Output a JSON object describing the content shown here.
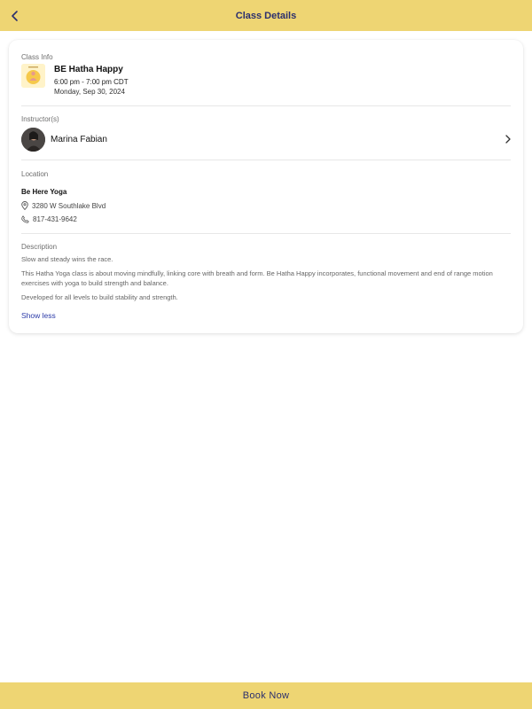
{
  "header": {
    "title": "Class Details"
  },
  "class_info": {
    "label": "Class Info",
    "title": "BE Hatha Happy",
    "time": "6:00 pm - 7:00 pm CDT",
    "date": "Monday, Sep 30, 2024"
  },
  "instructors": {
    "label": "Instructor(s)",
    "name": "Marina Fabian"
  },
  "location": {
    "label": "Location",
    "name": "Be Here Yoga",
    "address": "3280 W Southlake Blvd",
    "phone": "817-431-9642"
  },
  "description": {
    "label": "Description",
    "line1": "Slow and steady wins the race.",
    "line2": "This Hatha Yoga class is about moving mindfully, linking core with breath and form. Be Hatha Happy incorporates, functional movement and end of range motion exercises with yoga to build strength and balance.",
    "line3": "Developed for all levels to build stability and strength.",
    "toggle": "Show less"
  },
  "footer": {
    "book_label": "Book Now"
  },
  "colors": {
    "accent": "#EED573",
    "title_text": "#2b2f6e",
    "link": "#2b3aa8"
  }
}
